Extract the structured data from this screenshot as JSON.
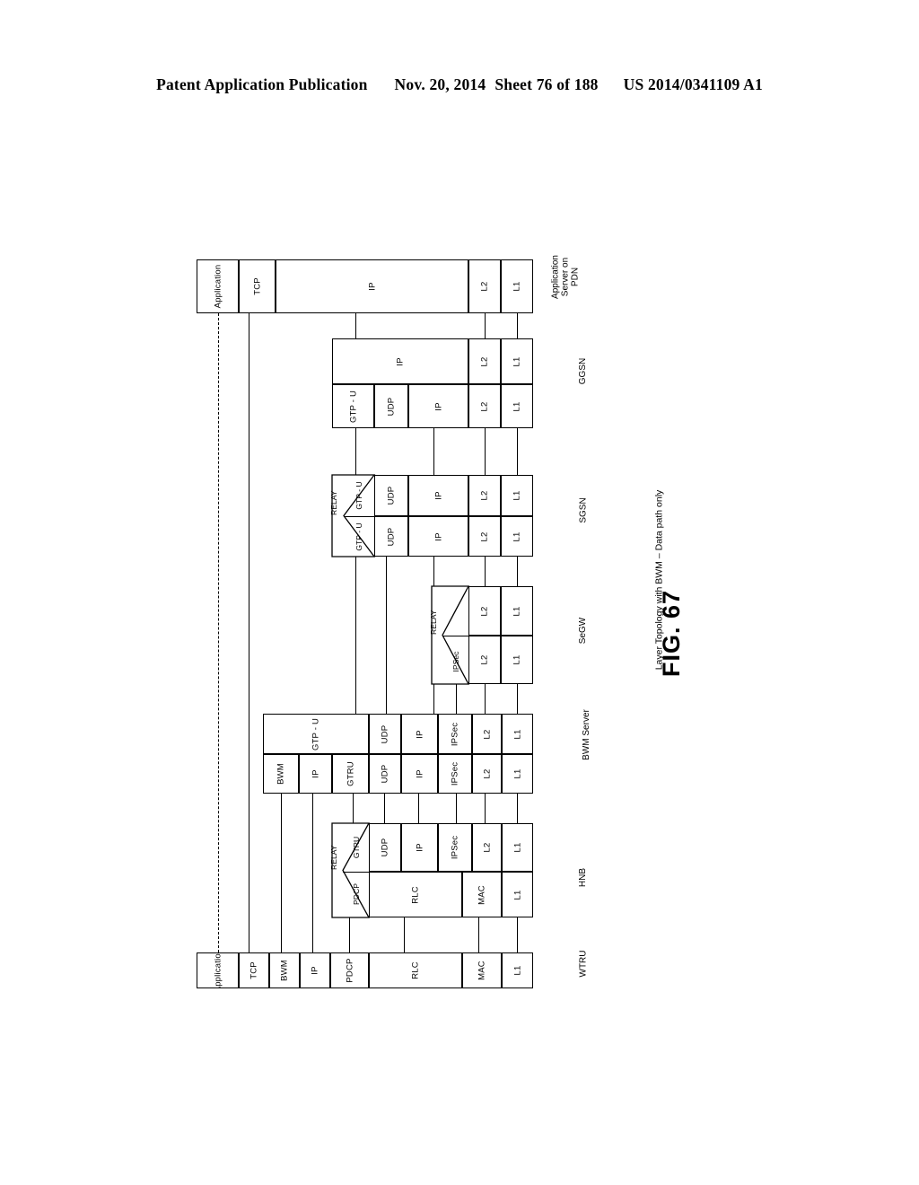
{
  "header": {
    "publication": "Patent Application Publication",
    "date": "Nov. 20, 2014",
    "sheet": "Sheet 76 of 188",
    "patent_number": "US 2014/0341109 A1"
  },
  "figure": {
    "number": "FIG. 67",
    "caption": "Layer Topology with BWM – Data path only"
  },
  "nodes": [
    {
      "id": "app_server",
      "label": "Application\nServer on\nPDN",
      "label_lines": [
        "Application",
        "Server on",
        "PDN"
      ]
    },
    {
      "id": "ggsn",
      "label": "GGSN"
    },
    {
      "id": "sgsn",
      "label": "SGSN"
    },
    {
      "id": "segw",
      "label": "SeGW"
    },
    {
      "id": "bwm",
      "label": "BWM Server"
    },
    {
      "id": "hnb",
      "label": "HNB"
    },
    {
      "id": "wtru",
      "label": "WTRU"
    }
  ],
  "stacks": {
    "app_server": {
      "node_label": "Application Server on PDN",
      "rows": [
        {
          "cells": [
            "Application",
            "TCP",
            "IP",
            "L2",
            "L1"
          ]
        }
      ]
    },
    "ggsn": {
      "node_label": "GGSN",
      "rows": [
        {
          "cells": [
            "IP",
            "L2",
            "L1"
          ]
        },
        {
          "cells": [
            "GTP - U",
            "UDP",
            "IP",
            "L2",
            "L1"
          ]
        }
      ]
    },
    "sgsn": {
      "node_label": "SGSN",
      "relay": {
        "label": "RELAY",
        "upper": "GTP - U",
        "lower": "GTP - U"
      },
      "rows": [
        {
          "cells": [
            "GTP - U",
            "UDP",
            "IP",
            "L2",
            "L1"
          ]
        },
        {
          "cells": [
            "GTP - U",
            "UDP",
            "IP",
            "L2",
            "L1"
          ]
        }
      ]
    },
    "segw": {
      "node_label": "SeGW",
      "relay": {
        "label": "RELAY",
        "upper": "",
        "lower": "IPSec"
      },
      "rows": [
        {
          "cells": [
            "L2",
            "L1"
          ]
        },
        {
          "cells": [
            "IPSec",
            "L2",
            "L1"
          ]
        }
      ]
    },
    "bwm": {
      "node_label": "BWM Server",
      "rows": [
        {
          "cells": [
            "GTP - U",
            "UDP",
            "IP",
            "IPSec",
            "L2",
            "L1"
          ]
        },
        {
          "cells": [
            "BWM",
            "IP",
            "GTRU",
            "UDP",
            "IP",
            "IPSec",
            "L2",
            "L1"
          ]
        }
      ]
    },
    "hnb": {
      "node_label": "HNB",
      "relay": {
        "label": "RELAY",
        "upper": "GTRU",
        "lower": "PDCP"
      },
      "rows": [
        {
          "cells": [
            "GTRU",
            "UDP",
            "IP",
            "IPSec",
            "L2",
            "L1"
          ]
        },
        {
          "cells": [
            "PDCP",
            "RLC",
            "MAC",
            "L1"
          ]
        }
      ]
    },
    "wtru": {
      "node_label": "WTRU",
      "rows": [
        {
          "cells": [
            "Application",
            "TCP",
            "BWM",
            "IP",
            "PDCP",
            "RLC",
            "MAC",
            "L1"
          ]
        }
      ]
    }
  },
  "cell_labels": {
    "application": "Application",
    "tcp": "TCP",
    "ip": "IP",
    "l1": "L1",
    "l2": "L2",
    "gtpu": "GTP - U",
    "gtru": "GTRU",
    "udp": "UDP",
    "ipsec": "IPSec",
    "bwm": "BWM",
    "pdcp": "PDCP",
    "rlc": "RLC",
    "mac": "MAC",
    "relay": "RELAY"
  }
}
